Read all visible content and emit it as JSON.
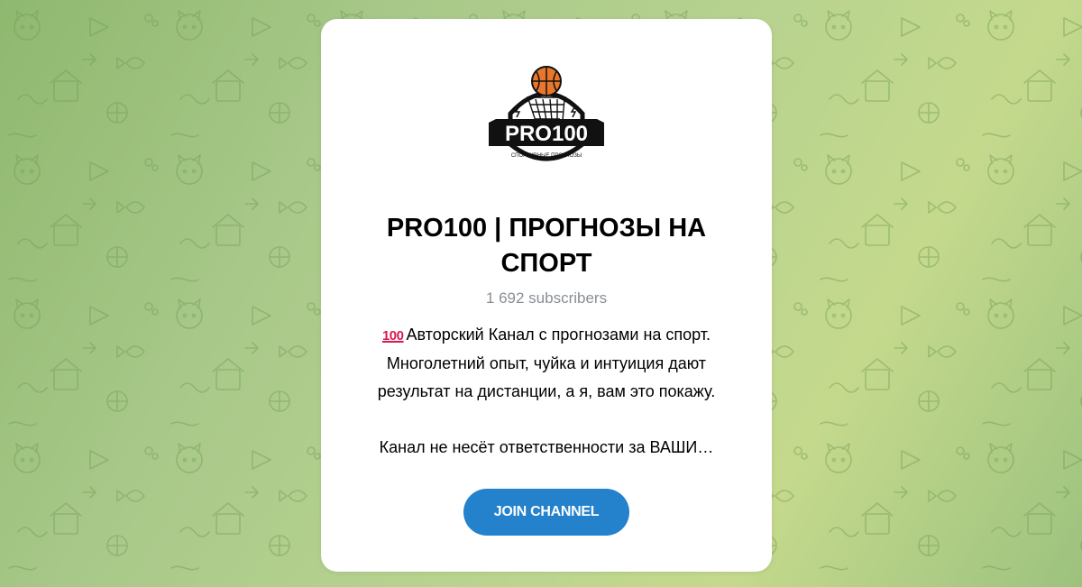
{
  "channel": {
    "logo": {
      "icon": "pro100-basketball-logo",
      "text": "PRO100",
      "caption": "СПОРТИВНЫЕ ПРОГНОЗЫ"
    },
    "title": "PRO100 | ПРОГНОЗЫ НА СПОРТ",
    "subscribers": "1 692 subscribers",
    "description": {
      "emoji": "100",
      "line1": "Авторский Канал с прогнозами на спорт.",
      "line2": "Многолетний опыт, чуйка и интуиция дают",
      "line3": "результат на дистанции, а я, вам это покажу.",
      "line4": "Канал не несёт ответственности за ВАШИ…"
    },
    "join_label": "JOIN CHANNEL"
  },
  "colors": {
    "background": "#a9c98a",
    "card": "#ffffff",
    "button": "#2481cc",
    "subscribers_text": "#8a8f94"
  }
}
